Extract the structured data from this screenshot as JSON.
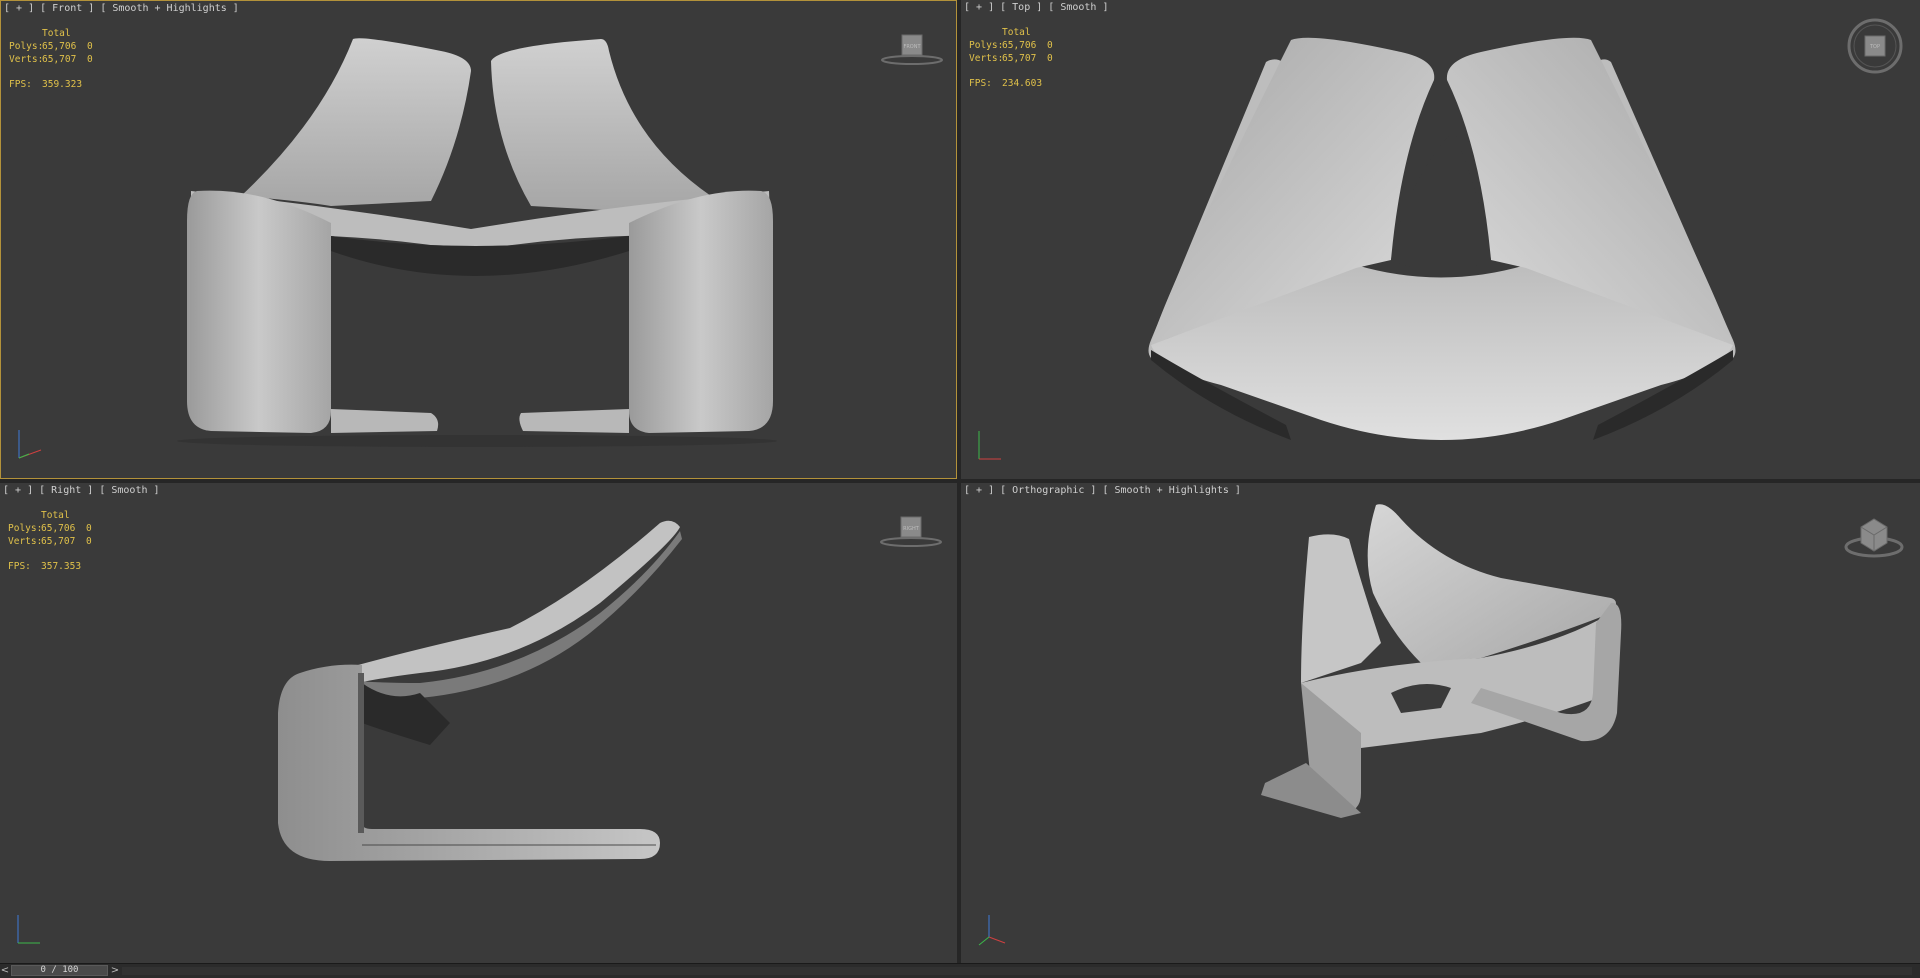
{
  "viewports": {
    "front": {
      "label": "[ + ] [ Front ] [ Smooth + Highlights ]",
      "stats_header": "Total",
      "polys_label": "Polys:",
      "polys_total": "65,706",
      "polys_sel": "0",
      "verts_label": "Verts:",
      "verts_total": "65,707",
      "verts_sel": "0",
      "fps_label": "FPS:",
      "fps_value": "359.323",
      "cube_face": "FRONT"
    },
    "top": {
      "label": "[ + ] [ Top ] [ Smooth ]",
      "stats_header": "Total",
      "polys_label": "Polys:",
      "polys_total": "65,706",
      "polys_sel": "0",
      "verts_label": "Verts:",
      "verts_total": "65,707",
      "verts_sel": "0",
      "fps_label": "FPS:",
      "fps_value": "234.603",
      "cube_face": "TOP"
    },
    "right": {
      "label": "[ + ] [ Right ] [ Smooth ]",
      "stats_header": "Total",
      "polys_label": "Polys:",
      "polys_total": "65,706",
      "polys_sel": "0",
      "verts_label": "Verts:",
      "verts_total": "65,707",
      "verts_sel": "0",
      "fps_label": "FPS:",
      "fps_value": "357.353",
      "cube_face": "RIGHT"
    },
    "orthographic": {
      "label": "[ + ] [ Orthographic ] [ Smooth + Highlights ]"
    }
  },
  "timeline": {
    "prev": "<",
    "position": "0 / 100",
    "next": ">"
  },
  "colors": {
    "viewport_bg": "#3a3a3a",
    "active_border": "#b3923a",
    "stats_text": "#e0c14a",
    "label_text": "#cfcfcf"
  },
  "icons": {
    "viewcube": "viewcube-icon",
    "axis_tripod": "axis-tripod-icon"
  }
}
